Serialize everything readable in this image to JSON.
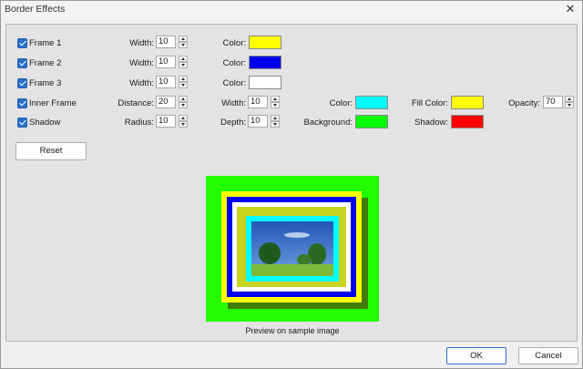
{
  "window": {
    "title": "Border Effects"
  },
  "rows": [
    {
      "label": "Frame 1",
      "checked": true,
      "param1_label": "Width:",
      "param1_value": "10",
      "color_label": "Color:",
      "color": "#ffff00"
    },
    {
      "label": "Frame 2",
      "checked": true,
      "param1_label": "Width:",
      "param1_value": "10",
      "color_label": "Color:",
      "color": "#0000ee"
    },
    {
      "label": "Frame 3",
      "checked": true,
      "param1_label": "Width:",
      "param1_value": "10",
      "color_label": "Color:",
      "color": "#ffffff"
    },
    {
      "label": "Inner Frame",
      "checked": true,
      "param1_label": "Distance:",
      "param1_value": "20",
      "param2_label": "Width:",
      "param2_value": "10",
      "color_label": "Color:",
      "color": "#00ffff",
      "fill_label": "Fill Color:",
      "fill_color": "#ffff00",
      "opacity_label": "Opacity:",
      "opacity_value": "70"
    },
    {
      "label": "Shadow",
      "checked": true,
      "param1_label": "Radius:",
      "param1_value": "10",
      "param2_label": "Depth:",
      "param2_value": "10",
      "bg_label": "Background:",
      "bg_color": "#00ff00",
      "shadow_label": "Shadow:",
      "shadow_color": "#ff0000"
    }
  ],
  "reset_label": "Reset",
  "preview": {
    "caption": "Preview on sample image"
  },
  "footer": {
    "ok_label": "OK",
    "cancel_label": "Cancel"
  },
  "icons": {
    "close": "close-icon",
    "checkbox": "checkmark-icon",
    "spin": "spinner-arrows-icon"
  }
}
